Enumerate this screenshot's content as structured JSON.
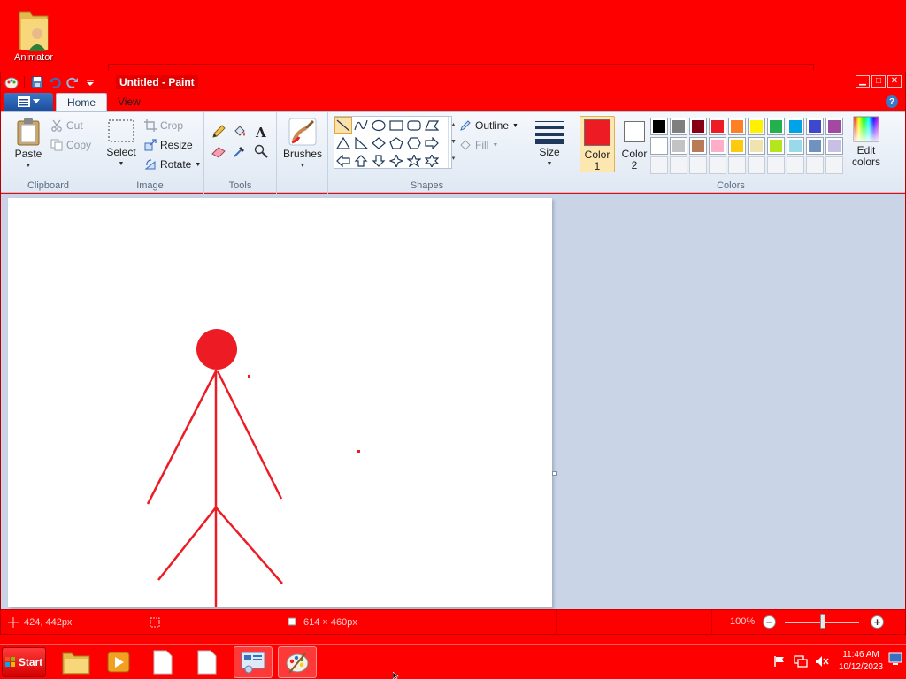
{
  "desktop": {
    "icons": [
      {
        "label": "Animator",
        "icon": "folder-user-icon"
      }
    ]
  },
  "window": {
    "title": "Untitled - Paint",
    "controls": {
      "minimize": "▁",
      "maximize": "□",
      "close": "✕"
    }
  },
  "tabs": {
    "home": "Home",
    "view": "View",
    "help": "?"
  },
  "ribbon": {
    "clipboard": {
      "label": "Clipboard",
      "paste": "Paste",
      "cut": "Cut",
      "copy": "Copy"
    },
    "image": {
      "label": "Image",
      "select": "Select",
      "crop": "Crop",
      "resize": "Resize",
      "rotate": "Rotate"
    },
    "tools": {
      "label": "Tools"
    },
    "brushes": {
      "label": "Brushes"
    },
    "shapes": {
      "label": "Shapes",
      "outline": "Outline",
      "fill": "Fill"
    },
    "size": {
      "label": "Size"
    },
    "colors": {
      "label": "Colors",
      "color1_line1": "Color",
      "color1_line2": "1",
      "color2_line1": "Color",
      "color2_line2": "2",
      "edit_line1": "Edit",
      "edit_line2": "colors",
      "color1": "#ed1c24",
      "color2": "#ffffff",
      "palette_row1": [
        "#000000",
        "#7f7f7f",
        "#880015",
        "#ed1c24",
        "#ff7f27",
        "#fff200",
        "#22b14c",
        "#00a2e8",
        "#3f48cc",
        "#a349a4"
      ],
      "palette_row2": [
        "#ffffff",
        "#c3c3c3",
        "#b97a57",
        "#ffaec9",
        "#ffc90e",
        "#efe4b0",
        "#b5e61d",
        "#99d9ea",
        "#7092be",
        "#c8bfe7"
      ]
    }
  },
  "canvas": {
    "background": "#ffffff",
    "stroke_color": "#ed1c24"
  },
  "statusbar": {
    "cursor_pos": "424, 442px",
    "selection_size": "",
    "canvas_size": "614 × 460px",
    "zoom": "100%"
  },
  "taskbar": {
    "start": "Start",
    "clock_time": "11:46 AM",
    "clock_date": "10/12/2023"
  }
}
